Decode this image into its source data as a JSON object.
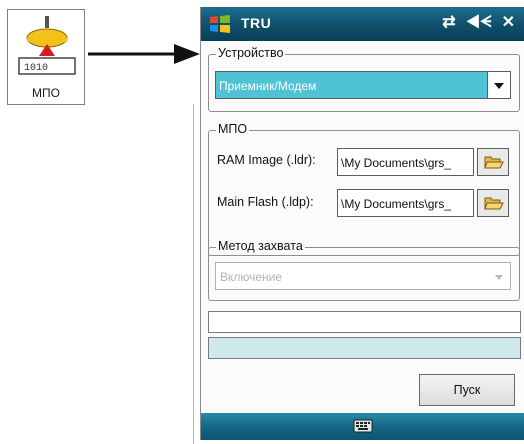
{
  "launcher": {
    "label": "МПО"
  },
  "window": {
    "title": "TRU"
  },
  "device_group": {
    "title": "Устройство",
    "selected": "Приемник/Модем"
  },
  "mpo_group": {
    "title": "МПО",
    "ram_label": "RAM Image (.ldr):",
    "ram_value": "\\My Documents\\grs_",
    "flash_label": "Main Flash (.ldp):",
    "flash_value": "\\My Documents\\grs_"
  },
  "capture_group": {
    "title": "Метод захвата",
    "selected": "Включение"
  },
  "status_text": "",
  "progress": 0,
  "start_label": "Пуск",
  "icons": {
    "window_logo": "windows-logo-icon",
    "connectivity": "connectivity-icon",
    "volume": "volume-icon",
    "close": "close-icon",
    "browse": "folder-open-icon",
    "keyboard": "keyboard-icon"
  },
  "colors": {
    "titlebar": "#0e4c67",
    "selection": "#4fc3d3",
    "progress_track": "#cfe9ec"
  }
}
